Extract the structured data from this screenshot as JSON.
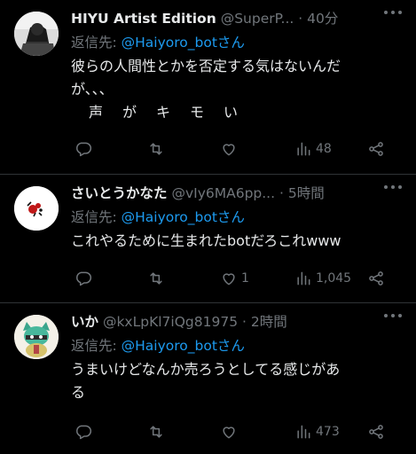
{
  "tweets": [
    {
      "name": "HIYU Artist Edition",
      "handle": "@SuperP...",
      "dot": "·",
      "time": "40分",
      "reply_prefix": "返信先: ",
      "reply_to": "@Haiyoro_botさん",
      "lines": [
        "彼らの人間性とかを否定する気はないんだ",
        "が、、、",
        "声がキモい"
      ],
      "replies": "",
      "retweets": "",
      "likes": "",
      "views": "48"
    },
    {
      "name": "さいとうかなた",
      "handle": "@vIy6MA6pp...",
      "dot": "·",
      "time": "5時間",
      "reply_prefix": "返信先: ",
      "reply_to": "@Haiyoro_botさん",
      "lines": [
        "これやるために生まれたbotだろこれwww"
      ],
      "replies": "",
      "retweets": "",
      "likes": "1",
      "views": "1,045"
    },
    {
      "name": "いか",
      "handle": "@kxLpKl7iQg81975",
      "dot": "·",
      "time": "2時間",
      "reply_prefix": "返信先: ",
      "reply_to": "@Haiyoro_botさん",
      "lines": [
        "うまいけどなんか売ろうとしてる感じがあ",
        "る"
      ],
      "replies": "",
      "retweets": "",
      "likes": "",
      "views": "473"
    }
  ],
  "icons": {
    "reply": "reply-icon",
    "retweet": "retweet-icon",
    "like": "heart-icon",
    "views": "views-icon",
    "share": "share-icon",
    "more": "more-icon"
  },
  "colors": {
    "background": "#000000",
    "text": "#e7e9ea",
    "muted": "#71767b",
    "link": "#1d9bf0",
    "divider": "#2f3336"
  }
}
